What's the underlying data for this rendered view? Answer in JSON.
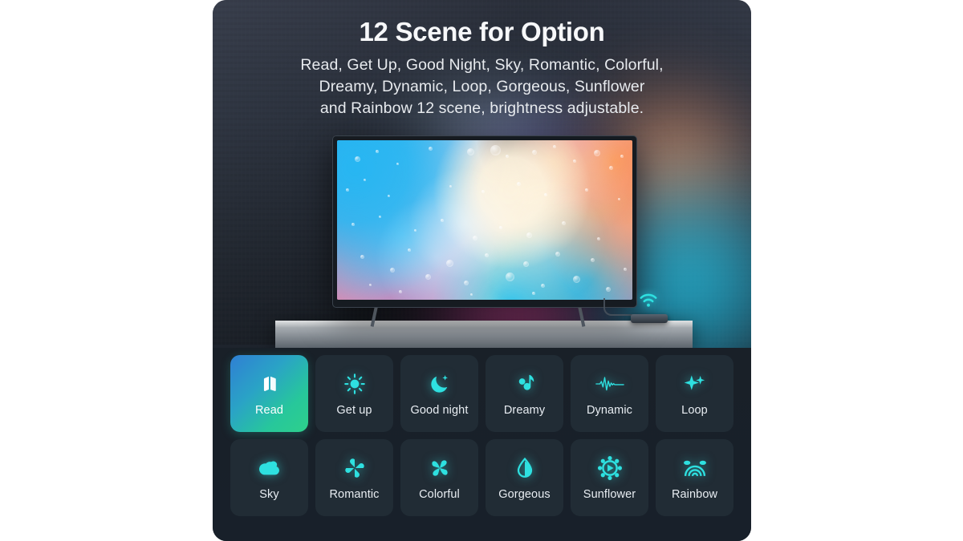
{
  "header": {
    "title": "12 Scene for Option",
    "subtitle_lines": [
      "Read, Get Up, Good Night, Sky, Romantic, Colorful,",
      "Dreamy, Dynamic, Loop, Gorgeous, Sunflower",
      "and Rainbow 12 scene, brightness adjustable."
    ]
  },
  "hero": {
    "device": "smart-tv-with-ambient-backlight",
    "wifi_indicator": "wifi-icon",
    "glow_colors": {
      "left": "#e0509d",
      "right": "#22c9ea",
      "top_right": "#ffb07a",
      "violet": "#7f63d8"
    }
  },
  "theme": {
    "card_background": "#1d232c",
    "panel_background": "#192028",
    "tile_background": "#212c35",
    "icon_accent": "#2ee0e0",
    "active_gradient_from": "#2f7fd4",
    "active_gradient_to": "#2ed08b",
    "text_primary": "#f7f8fa",
    "text_secondary": "#e7eaee"
  },
  "scenes": {
    "selected": "Read",
    "rows": [
      [
        {
          "label": "Read",
          "icon": "book-icon",
          "active": true
        },
        {
          "label": "Get up",
          "icon": "sun-icon",
          "active": false
        },
        {
          "label": "Good night",
          "icon": "moon-icon",
          "active": false
        },
        {
          "label": "Dreamy",
          "icon": "music-note-icon",
          "active": false
        },
        {
          "label": "Dynamic",
          "icon": "waveform-icon",
          "active": false
        },
        {
          "label": "Loop",
          "icon": "sparkles-icon",
          "active": false
        }
      ],
      [
        {
          "label": "Sky",
          "icon": "cloud-icon",
          "active": false
        },
        {
          "label": "Romantic",
          "icon": "clover-icon",
          "active": false
        },
        {
          "label": "Colorful",
          "icon": "pinwheel-icon",
          "active": false
        },
        {
          "label": "Gorgeous",
          "icon": "droplet-icon",
          "active": false
        },
        {
          "label": "Sunflower",
          "icon": "flower-icon",
          "active": false
        },
        {
          "label": "Rainbow",
          "icon": "rainbow-icon",
          "active": false
        }
      ]
    ]
  }
}
